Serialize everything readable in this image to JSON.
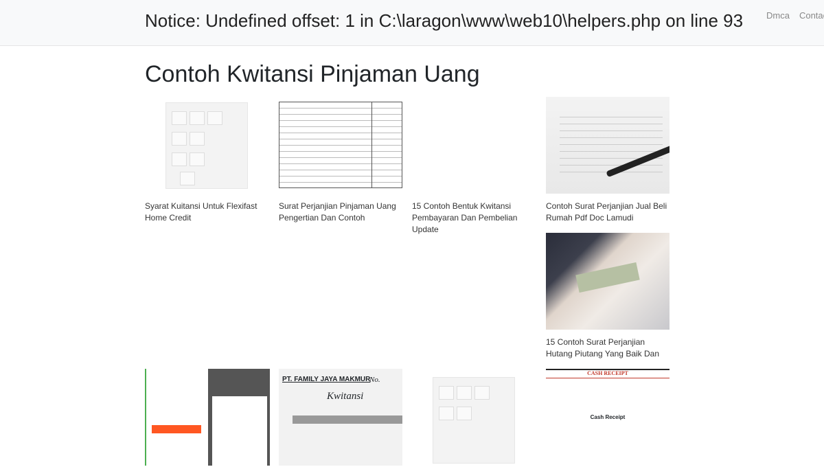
{
  "header": {
    "notice": "Notice: Undefined offset: 1 in C:\\laragon\\www\\web10\\helpers.php on line 93",
    "nav": [
      "Dmca",
      "Contact"
    ]
  },
  "page_title": "Contoh Kwitansi Pinjaman Uang",
  "posts": [
    {
      "title": "Syarat Kuitansi Untuk Flexifast Home Credit",
      "image": "dresser"
    },
    {
      "title": "Surat Perjanjian Pinjaman Uang Pengertian Dan Contoh",
      "image": "document-table"
    },
    {
      "title": "15 Contoh Bentuk Kwitansi Pembayaran Dan Pembelian Update",
      "image": "blank"
    },
    {
      "title": "Contoh Surat Perjanjian Jual Beli Rumah Pdf Doc Lamudi",
      "image": "pen-signature"
    },
    {
      "title": "15 Contoh Surat Perjanjian Hutang Piutang Yang Baik Dan",
      "image": "money-handover"
    },
    {
      "title": "",
      "image": "app-screenshot"
    },
    {
      "title": "",
      "image": "kwitansi-form",
      "text": [
        "PT. FAMILY JAYA MAKMUR",
        "No.",
        "Kwitansi"
      ]
    },
    {
      "title": "",
      "image": "dresser"
    },
    {
      "title": "",
      "image": "cash-receipt",
      "text": [
        "CASH RECEIPT",
        "Cash Receipt"
      ]
    }
  ]
}
